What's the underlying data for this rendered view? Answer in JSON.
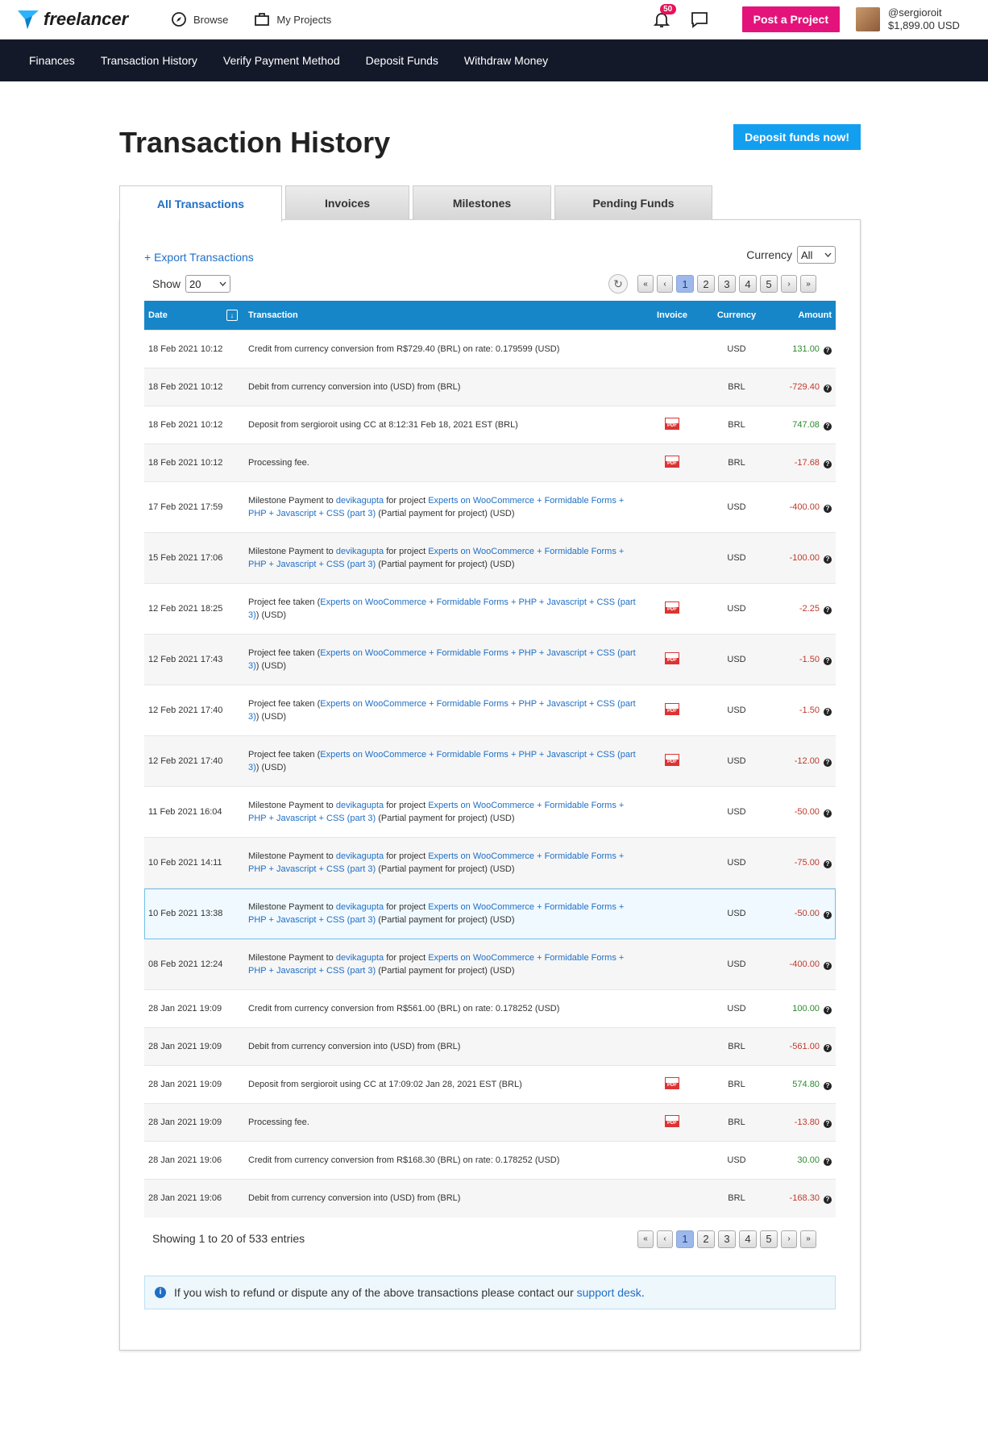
{
  "topbar": {
    "logo_text": "freelancer",
    "browse": "Browse",
    "my_projects": "My Projects",
    "notif_count": "50",
    "post_project": "Post a Project",
    "username": "@sergioroit",
    "balance": "$1,899.00 USD"
  },
  "subnav": [
    "Finances",
    "Transaction History",
    "Verify Payment Method",
    "Deposit Funds",
    "Withdraw Money"
  ],
  "page": {
    "title": "Transaction History",
    "deposit_now": "Deposit funds now!"
  },
  "tabs": [
    "All Transactions",
    "Invoices",
    "Milestones",
    "Pending Funds"
  ],
  "controls": {
    "export": "+ Export Transactions",
    "currency_label": "Currency",
    "currency_value": "All",
    "show_label": "Show",
    "show_value": "20"
  },
  "pager": [
    "«",
    "‹",
    "1",
    "2",
    "3",
    "4",
    "5",
    "›",
    "»"
  ],
  "table": {
    "headers": [
      "Date",
      "Transaction",
      "Invoice",
      "Currency",
      "Amount"
    ]
  },
  "text": {
    "mp": "Milestone Payment to ",
    "for_project": " for project ",
    "partial": " (Partial payment for project) (USD)",
    "pf": "Project fee taken (",
    "usd_suffix": ") (USD)",
    "devika": "devikagupta",
    "project": "Experts on WooCommerce + Formidable Forms + PHP + Javascript + CSS (part 3)"
  },
  "rows": [
    {
      "date": "18 Feb 2021 10:12",
      "kind": "plain",
      "text": "Credit from currency conversion from R$729.40 (BRL) on rate: 0.179599 (USD)",
      "pdf": false,
      "currency": "USD",
      "amount": "131.00",
      "sign": "pos"
    },
    {
      "date": "18 Feb 2021 10:12",
      "kind": "plain",
      "text": "Debit from currency conversion into (USD) from (BRL)",
      "pdf": false,
      "currency": "BRL",
      "amount": "-729.40",
      "sign": "neg"
    },
    {
      "date": "18 Feb 2021 10:12",
      "kind": "plain",
      "text": "Deposit from sergioroit using CC at 8:12:31 Feb 18, 2021 EST (BRL)",
      "pdf": true,
      "currency": "BRL",
      "amount": "747.08",
      "sign": "pos"
    },
    {
      "date": "18 Feb 2021 10:12",
      "kind": "plain",
      "text": "Processing fee.",
      "pdf": true,
      "currency": "BRL",
      "amount": "-17.68",
      "sign": "neg"
    },
    {
      "date": "17 Feb 2021 17:59",
      "kind": "milestone",
      "pdf": false,
      "currency": "USD",
      "amount": "-400.00",
      "sign": "neg"
    },
    {
      "date": "15 Feb 2021 17:06",
      "kind": "milestone",
      "pdf": false,
      "currency": "USD",
      "amount": "-100.00",
      "sign": "neg"
    },
    {
      "date": "12 Feb 2021 18:25",
      "kind": "fee",
      "pdf": true,
      "currency": "USD",
      "amount": "-2.25",
      "sign": "neg"
    },
    {
      "date": "12 Feb 2021 17:43",
      "kind": "fee",
      "pdf": true,
      "currency": "USD",
      "amount": "-1.50",
      "sign": "neg"
    },
    {
      "date": "12 Feb 2021 17:40",
      "kind": "fee",
      "pdf": true,
      "currency": "USD",
      "amount": "-1.50",
      "sign": "neg"
    },
    {
      "date": "12 Feb 2021 17:40",
      "kind": "fee",
      "pdf": true,
      "currency": "USD",
      "amount": "-12.00",
      "sign": "neg"
    },
    {
      "date": "11 Feb 2021 16:04",
      "kind": "milestone",
      "pdf": false,
      "currency": "USD",
      "amount": "-50.00",
      "sign": "neg"
    },
    {
      "date": "10 Feb 2021 14:11",
      "kind": "milestone",
      "pdf": false,
      "currency": "USD",
      "amount": "-75.00",
      "sign": "neg"
    },
    {
      "date": "10 Feb 2021 13:38",
      "kind": "milestone",
      "pdf": false,
      "currency": "USD",
      "amount": "-50.00",
      "sign": "neg",
      "highlight": true
    },
    {
      "date": "08 Feb 2021 12:24",
      "kind": "milestone",
      "pdf": false,
      "currency": "USD",
      "amount": "-400.00",
      "sign": "neg"
    },
    {
      "date": "28 Jan 2021 19:09",
      "kind": "plain",
      "text": "Credit from currency conversion from R$561.00 (BRL) on rate: 0.178252 (USD)",
      "pdf": false,
      "currency": "USD",
      "amount": "100.00",
      "sign": "pos"
    },
    {
      "date": "28 Jan 2021 19:09",
      "kind": "plain",
      "text": "Debit from currency conversion into (USD) from (BRL)",
      "pdf": false,
      "currency": "BRL",
      "amount": "-561.00",
      "sign": "neg"
    },
    {
      "date": "28 Jan 2021 19:09",
      "kind": "plain",
      "text": "Deposit from sergioroit using CC at 17:09:02 Jan 28, 2021 EST (BRL)",
      "pdf": true,
      "currency": "BRL",
      "amount": "574.80",
      "sign": "pos"
    },
    {
      "date": "28 Jan 2021 19:09",
      "kind": "plain",
      "text": "Processing fee.",
      "pdf": true,
      "currency": "BRL",
      "amount": "-13.80",
      "sign": "neg"
    },
    {
      "date": "28 Jan 2021 19:06",
      "kind": "plain",
      "text": "Credit from currency conversion from R$168.30 (BRL) on rate: 0.178252 (USD)",
      "pdf": false,
      "currency": "USD",
      "amount": "30.00",
      "sign": "pos"
    },
    {
      "date": "28 Jan 2021 19:06",
      "kind": "plain",
      "text": "Debit from currency conversion into (USD) from (BRL)",
      "pdf": false,
      "currency": "BRL",
      "amount": "-168.30",
      "sign": "neg"
    }
  ],
  "footer": {
    "showing": "Showing 1 to 20 of 533 entries",
    "notice_prefix": "If you wish to refund or dispute any of the above transactions please contact our ",
    "notice_link": "support desk",
    "notice_suffix": "."
  },
  "icons": {
    "pdf": "PDF",
    "help": "?",
    "info": "i",
    "refresh": "↻",
    "sort": "↓"
  }
}
